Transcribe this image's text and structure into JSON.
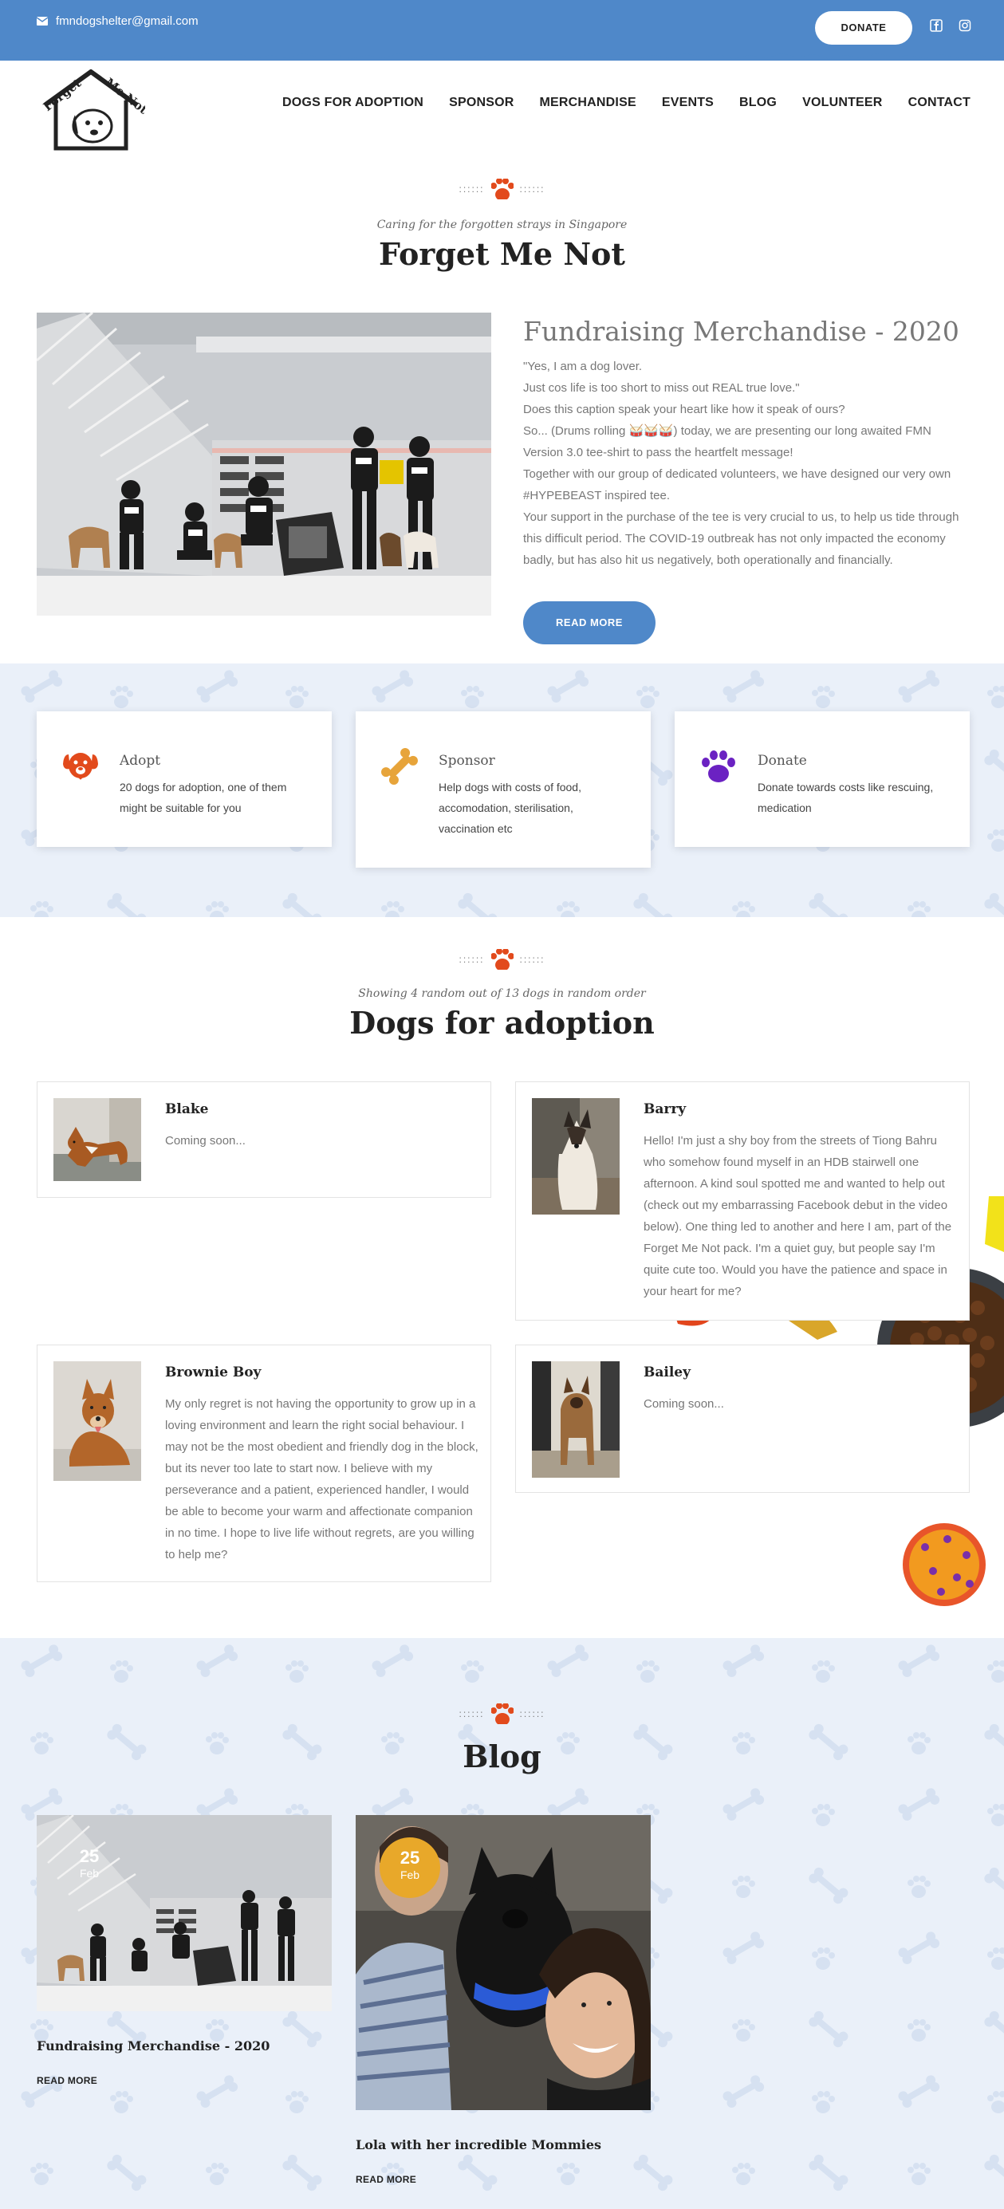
{
  "topbar": {
    "email": "fmndogshelter@gmail.com",
    "donate_label": "DONATE"
  },
  "header": {
    "logo_text": "Forget Me Not",
    "nav": [
      "DOGS FOR ADOPTION",
      "SPONSOR",
      "MERCHANDISE",
      "EVENTS",
      "BLOG",
      "VOLUNTEER",
      "CONTACT"
    ]
  },
  "intro": {
    "tagline": "Caring for the forgotten strays in Singapore",
    "title": "Forget Me Not"
  },
  "featured": {
    "title": "Fundraising Merchandise - 2020",
    "paragraphs": [
      "\"Yes, I am a dog lover.",
      "Just cos life is too short to miss out REAL true love.\"",
      "Does this caption speak your heart like how it speak of ours?",
      "So... (Drums rolling 🥁🥁🥁) today, we are presenting our long awaited FMN Version 3.0 tee-shirt to pass the heartfelt message!",
      "Together with our group of dedicated volunteers, we have designed our very own #HYPEBEAST inspired tee.",
      "Your support in the purchase of the tee is very crucial to us, to help us tide through this difficult period. The COVID-19 outbreak has not only impacted the economy badly, but has also hit us negatively, both operationally and financially."
    ],
    "read_more": "READ MORE"
  },
  "features": [
    {
      "icon": "dog-face-icon",
      "title": "Adopt",
      "text": "20 dogs for adoption, one of them might be suitable for you",
      "color": "#e24a1c"
    },
    {
      "icon": "bone-icon",
      "title": "Sponsor",
      "text": "Help dogs with costs of food, accomodation, sterilisation, vaccination etc",
      "color": "#e7a43a"
    },
    {
      "icon": "paw-icon",
      "title": "Donate",
      "text": "Donate towards costs like rescuing, medication",
      "color": "#6b22c2"
    }
  ],
  "adoption": {
    "tagline": "Showing 4 random out of 13 dogs in random order",
    "title": "Dogs for adoption",
    "dogs": [
      {
        "name": "Blake",
        "desc": "Coming soon..."
      },
      {
        "name": "Barry",
        "desc": "Hello! I'm just a shy boy from the streets of Tiong Bahru who somehow found myself in an HDB stairwell one afternoon. A kind soul spotted me and wanted to help out (check out my embarrassing Facebook debut in the video below). One thing led to another and here I am, part of the Forget Me Not pack. I'm a quiet guy, but people say I'm quite cute too. Would you have the patience and space in your heart for me?"
      },
      {
        "name": "Brownie Boy",
        "desc": "My only regret is not having the opportunity to grow up in a loving environment and learn the right social behaviour. I may not be the most obedient and friendly dog in the block, but its never too late to start now. I believe with my perseverance and a patient, experienced handler, I would be able to become your warm and affectionate companion in no time. I hope to live life without regrets, are you willing to help me?"
      },
      {
        "name": "Bailey",
        "desc": "Coming soon..."
      }
    ]
  },
  "blog": {
    "title": "Blog",
    "posts": [
      {
        "day": "25",
        "month": "Feb",
        "title": "Fundraising Merchandise - 2020",
        "more": "READ MORE"
      },
      {
        "day": "25",
        "month": "Feb",
        "title": "Lola with her incredible Mommies",
        "more": "READ MORE"
      }
    ]
  },
  "colors": {
    "brand_blue": "#4f88c9",
    "paw_orange": "#e24a1c",
    "badge_yellow": "#e8a82a",
    "pattern_bg": "#eaf0f9"
  }
}
